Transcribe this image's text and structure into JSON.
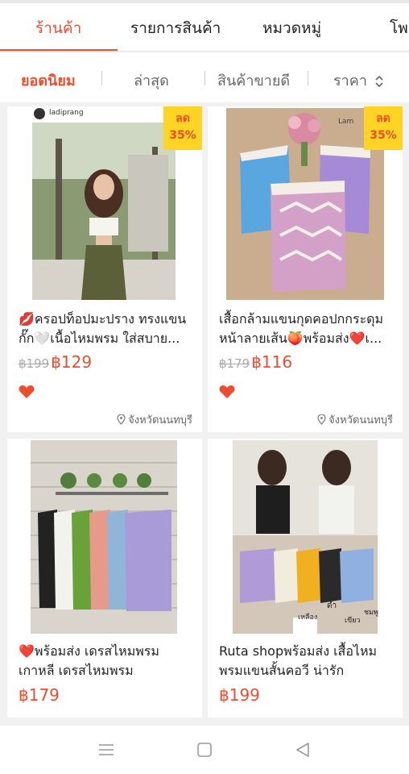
{
  "tabs": [
    {
      "label": "ร้านค้า",
      "active": true
    },
    {
      "label": "รายการสินค้า",
      "active": false
    },
    {
      "label": "หมวดหมู่",
      "active": false
    },
    {
      "label": "โพ",
      "active": false
    }
  ],
  "sort": [
    {
      "label": "ยอดนิยม",
      "active": true
    },
    {
      "label": "ล่าสุด"
    },
    {
      "label": "สินค้าขายดี"
    },
    {
      "label": "ราคา",
      "icon": "sort-updown-icon"
    }
  ],
  "products": [
    {
      "title": "💋ครอปท็อปมะปราง ทรงแขนกั๊ก🤍เนื้อไหมพรม ใส่สบาย...",
      "old_price": "฿199",
      "price": "฿129",
      "discount_label": "ลด",
      "discount_pct": "35%",
      "liked": true,
      "location": "จังหวัดนนทบุรี",
      "image_text": "ladiprang"
    },
    {
      "title": "เสื้อกล้ามแขนกุดคอปกกระดุมหน้าลายเส้น🍑พร้อมส่ง❤️เ...",
      "old_price": "฿179",
      "price": "฿116",
      "discount_label": "ลด",
      "discount_pct": "35%",
      "liked": true,
      "location": "จังหวัดนนทบุรี",
      "image_text": "Lam"
    },
    {
      "title": "❤️พร้อมส่ง เดรสไหมพรมเกาหลี เดรสไหมพรม",
      "price": "฿179"
    },
    {
      "title": "Ruta shopพร้อมส่ง เสื้อไหมพรมแขนสั้นคอวี น่ารัก",
      "price": "฿199",
      "image_labels": [
        "ดำ",
        "เหลือง",
        "เขียว",
        "ชมพู"
      ]
    }
  ],
  "colors": {
    "accent": "#ee4d2d",
    "badge": "#ffd424"
  },
  "navbar": {
    "icons": [
      "menu-icon",
      "home-square-icon",
      "back-triangle-icon"
    ]
  }
}
